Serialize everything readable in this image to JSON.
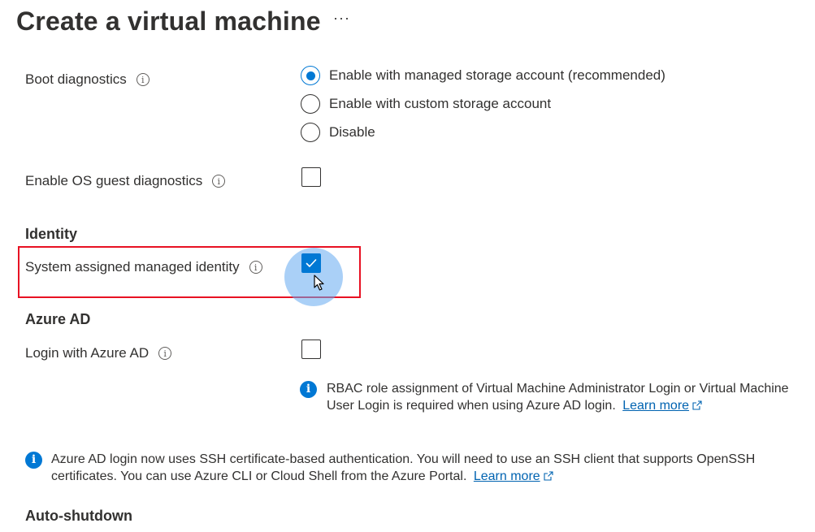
{
  "header": {
    "title": "Create a virtual machine",
    "more_label": "···"
  },
  "boot_diagnostics": {
    "label": "Boot diagnostics",
    "options": [
      {
        "label": "Enable with managed storage account (recommended)",
        "selected": true
      },
      {
        "label": "Enable with custom storage account",
        "selected": false
      },
      {
        "label": "Disable",
        "selected": false
      }
    ]
  },
  "os_guest_diagnostics": {
    "label": "Enable OS guest diagnostics",
    "checked": false
  },
  "identity": {
    "section_title": "Identity",
    "system_assigned": {
      "label": "System assigned managed identity",
      "checked": true
    }
  },
  "azure_ad": {
    "section_title": "Azure AD",
    "login": {
      "label": "Login with Azure AD",
      "checked": false
    },
    "rbac_info": {
      "line1": "RBAC role assignment of Virtual Machine Administrator Login or Virtual Machine",
      "line2": "User Login is required when using Azure AD login.",
      "link": "Learn more"
    }
  },
  "ssh_info": {
    "line1": "Azure AD login now uses SSH certificate-based authentication. You will need to use an SSH client that supports OpenSSH",
    "line2": "certificates. You can use Azure CLI or Cloud Shell from the Azure Portal.",
    "link": "Learn more"
  },
  "auto_shutdown": {
    "section_title": "Auto-shutdown"
  },
  "icons": {
    "info": "info-icon",
    "info_filled": "info-filled-icon",
    "external_link": "external-link-icon",
    "checkmark": "checkmark-icon",
    "cursor": "mouse-pointer-icon"
  },
  "colors": {
    "accent": "#0078d4",
    "link": "#0063b1",
    "highlight": "#e81123",
    "text": "#323130"
  }
}
